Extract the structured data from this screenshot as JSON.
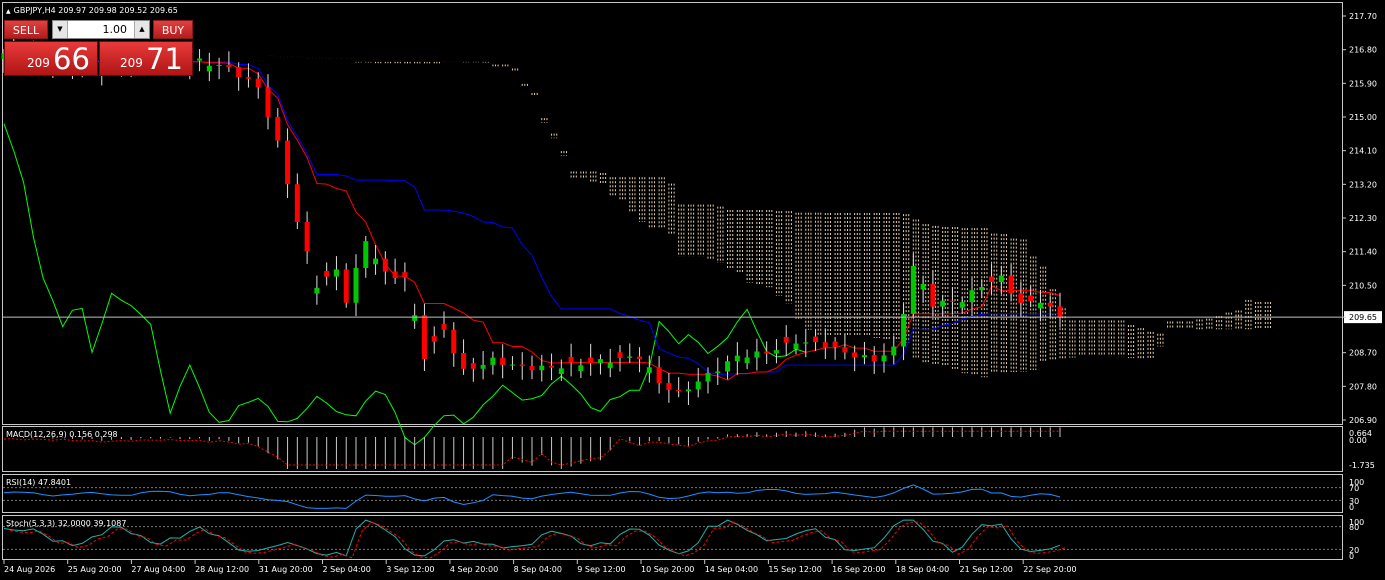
{
  "header": {
    "symbol": "GBPJPY,H4",
    "ohlc": "209.97 209.98 209.52 209.65",
    "collapse_glyph": "▲"
  },
  "trade_panel": {
    "sell_label": "SELL",
    "buy_label": "BUY",
    "lot_value": "1.00",
    "sell_small": "209",
    "sell_big": "66",
    "buy_small": "209",
    "buy_big": "71",
    "down_glyph": "▼",
    "up_glyph": "▲"
  },
  "indicators": {
    "macd": "MACD(12,26,9) 0.156 0.298",
    "rsi": "RSI(14) 47.8401",
    "stoch": "Stoch(5,3,3) 32.0000 39.1087"
  },
  "colors": {
    "background": "#000000",
    "axis": "#c8c8c8",
    "bull": "#00c800",
    "bear": "#ff0000",
    "tenkan": "#ff0000",
    "kijun": "#0000ff",
    "chikou": "#00ff00",
    "cloud": "#f5deb3",
    "indicator_line": "#1e90ff",
    "signal": "#ff0000",
    "price_line": "#c0c0c0"
  },
  "chart_data": {
    "type": "candlestick",
    "title": "GBPJPY,H4",
    "price_axis": {
      "labels": [
        "217.70",
        "216.80",
        "215.90",
        "215.00",
        "214.10",
        "213.20",
        "212.30",
        "211.40",
        "210.50",
        "209.65",
        "208.70",
        "207.80",
        "206.90"
      ],
      "ylim": [
        206.9,
        217.7
      ]
    },
    "current_price": "209.65",
    "time_labels": [
      "24 Aug 2026",
      "25 Aug 20:00",
      "27 Aug 04:00",
      "28 Aug 12:00",
      "31 Aug 20:00",
      "2 Sep 04:00",
      "3 Sep 12:00",
      "4 Sep 20:00",
      "8 Sep 04:00",
      "9 Sep 12:00",
      "10 Sep 20:00",
      "14 Sep 04:00",
      "15 Sep 12:00",
      "16 Sep 20:00",
      "18 Sep 04:00",
      "21 Sep 12:00",
      "22 Sep 20:00"
    ],
    "close_anchors": [
      [
        0,
        216.7
      ],
      [
        6,
        216.6
      ],
      [
        10,
        216.4
      ],
      [
        16,
        216.6
      ],
      [
        20,
        216.5
      ],
      [
        23,
        216.3
      ],
      [
        26,
        215.8
      ],
      [
        28,
        214.3
      ],
      [
        30,
        212.2
      ],
      [
        32,
        210.5
      ],
      [
        34,
        210.9
      ],
      [
        35,
        210.1
      ],
      [
        37,
        211.7
      ],
      [
        39,
        210.8
      ],
      [
        41,
        210.7
      ],
      [
        43,
        208.6
      ],
      [
        45,
        209.3
      ],
      [
        47,
        208.2
      ],
      [
        50,
        208.5
      ],
      [
        53,
        208.3
      ],
      [
        56,
        208.3
      ],
      [
        59,
        208.4
      ],
      [
        62,
        208.5
      ],
      [
        65,
        208.6
      ],
      [
        67,
        207.9
      ],
      [
        69,
        207.6
      ],
      [
        72,
        208.1
      ],
      [
        75,
        208.6
      ],
      [
        78,
        208.7
      ],
      [
        81,
        209.0
      ],
      [
        84,
        208.9
      ],
      [
        86,
        208.7
      ],
      [
        89,
        208.5
      ],
      [
        91,
        208.8
      ],
      [
        92,
        209.8
      ],
      [
        93,
        211.0
      ],
      [
        95,
        210.0
      ],
      [
        98,
        210.1
      ],
      [
        100,
        210.5
      ],
      [
        102,
        210.7
      ],
      [
        104,
        210.0
      ],
      [
        106,
        210.1
      ],
      [
        108,
        209.65
      ]
    ],
    "bear_bars": [
      23,
      24,
      25,
      26,
      27,
      28,
      29,
      30,
      31,
      33,
      35,
      39,
      40,
      41,
      43,
      44,
      45,
      46,
      47,
      48,
      51,
      53,
      54,
      56,
      58,
      60,
      63,
      65,
      67,
      68,
      69,
      78,
      80,
      83,
      84,
      85,
      86,
      87,
      89,
      95,
      97,
      101,
      103,
      104,
      105,
      107,
      108
    ],
    "macd_labels": [
      "0.664",
      "0.00",
      "-1.735"
    ],
    "rsi_labels": [
      "100",
      "70",
      "30",
      "0"
    ],
    "stoch_labels": [
      "100",
      "80",
      "20",
      "0"
    ]
  }
}
